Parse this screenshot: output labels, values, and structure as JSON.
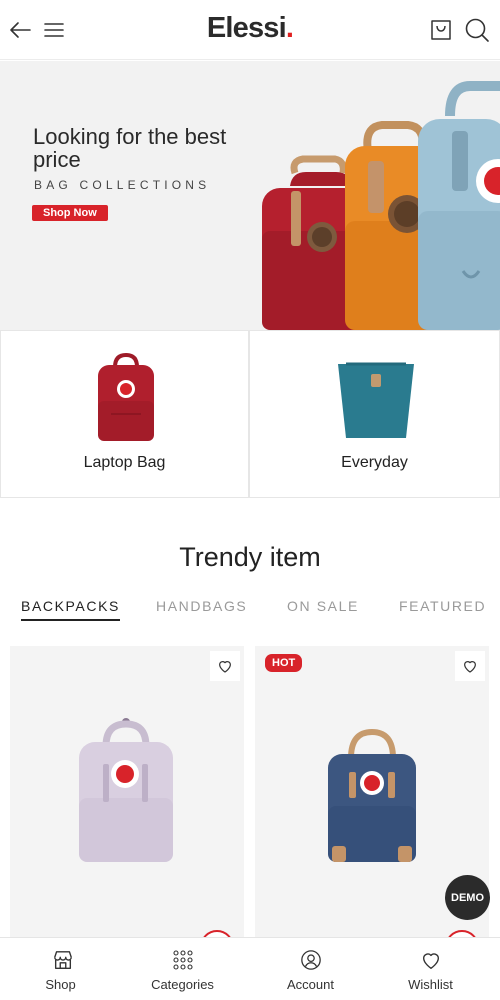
{
  "header": {
    "logo_text": "Elessi",
    "logo_dot": "."
  },
  "hero": {
    "title": "Looking for the best price",
    "subtitle": "BAG COLLECTIONS",
    "button_label": "Shop Now"
  },
  "categories": [
    {
      "label": "Laptop Bag"
    },
    {
      "label": "Everyday"
    }
  ],
  "trendy": {
    "title": "Trendy item",
    "tabs": [
      "BACKPACKS",
      "HANDBAGS",
      "ON SALE",
      "FEATURED"
    ],
    "active_tab": "BACKPACKS"
  },
  "products": [
    {
      "badge": "",
      "color": "lilac"
    },
    {
      "badge": "HOT",
      "color": "navy"
    }
  ],
  "demo_label": "DEMO",
  "bottom_nav": [
    {
      "label": "Shop",
      "icon": "store-icon"
    },
    {
      "label": "Categories",
      "icon": "grid-dots-icon"
    },
    {
      "label": "Account",
      "icon": "user-icon"
    },
    {
      "label": "Wishlist",
      "icon": "heart-icon"
    }
  ],
  "colors": {
    "accent": "#d8232a",
    "text": "#222222",
    "muted": "#9a9a9a"
  }
}
